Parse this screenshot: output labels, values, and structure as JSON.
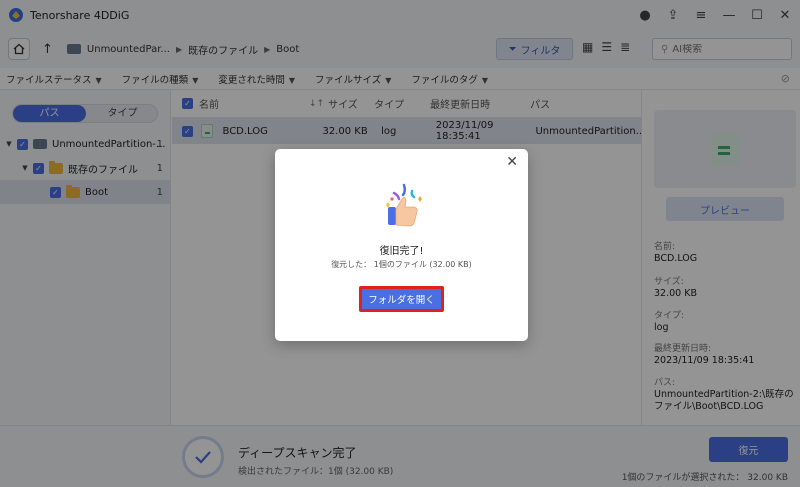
{
  "app": {
    "title": "Tenorshare 4DDiG"
  },
  "nav": {
    "breadcrumb": [
      "UnmountedPar...",
      "既存のファイル",
      "Boot"
    ],
    "filter_label": "フィルタ",
    "search_placeholder": "AI検索"
  },
  "filters": [
    "ファイルステータス",
    "ファイルの種類",
    "変更された時間",
    "ファイルサイズ",
    "ファイルのタグ"
  ],
  "left": {
    "toggle": {
      "active": "パス",
      "inactive": "タイプ"
    },
    "tree": [
      {
        "label": "UnmountedPartition-...",
        "count": "1"
      },
      {
        "label": "既存のファイル",
        "count": "1"
      },
      {
        "label": "Boot",
        "count": "1"
      }
    ]
  },
  "list": {
    "headers": {
      "name": "名前",
      "size": "サイズ",
      "type": "タイプ",
      "modified": "最終更新日時",
      "path": "パス"
    },
    "rows": [
      {
        "name": "BCD.LOG",
        "size": "32.00 KB",
        "type": "log",
        "modified": "2023/11/09 18:35:41",
        "path": "UnmountedPartition..."
      }
    ]
  },
  "preview": {
    "button": "プレビュー",
    "name_label": "名前:",
    "name": "BCD.LOG",
    "size_label": "サイズ:",
    "size": "32.00 KB",
    "type_label": "タイプ:",
    "type": "log",
    "modified_label": "最終更新日時:",
    "modified": "2023/11/09 18:35:41",
    "path_label": "パス:",
    "path": "UnmountedPartition-2:\\既存のファイル\\Boot\\BCD.LOG"
  },
  "bottom": {
    "scan_title": "ディープスキャン完了",
    "scan_sub": "検出されたファイル：1個 (32.00 KB)",
    "recover": "復元",
    "selected": "1個のファイルが選択された：  32.00 KB"
  },
  "modal": {
    "title": "復旧完了!",
    "sub": "復元した： 1個のファイル (32.00 KB)",
    "open_button": "フォルダを開く"
  },
  "colors": {
    "accent": "#4a6fe3",
    "highlight_border": "#e0231a"
  }
}
